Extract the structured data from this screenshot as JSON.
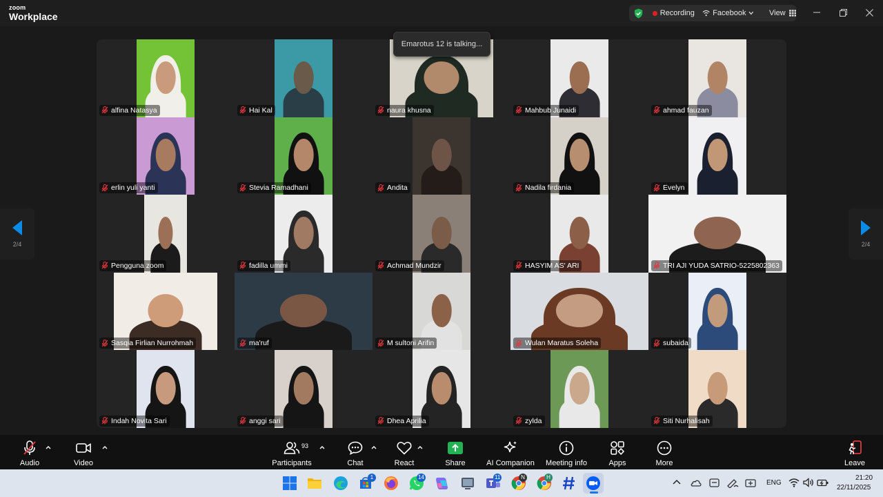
{
  "app": {
    "brand_top": "zoom",
    "brand_bottom": "Workplace"
  },
  "topbar": {
    "recording_label": "Recording",
    "stream_label": "Facebook",
    "view_label": "View"
  },
  "talking_indicator": "Emarotus 12 is talking...",
  "pagination": {
    "left": "2/4",
    "right": "2/4"
  },
  "participants": [
    {
      "name": "alfina Natasya",
      "bg": "#74c235",
      "skin": "#c99a7c",
      "cloth": "#f1efe9",
      "veil": true
    },
    {
      "name": "Hai Kal",
      "bg": "#3c9aa7",
      "skin": "#6a5a4a",
      "cloth": "#2a3e47",
      "veil": false
    },
    {
      "name": "naura khusna",
      "bg": "#d9d4c9",
      "skin": "#b08a6a",
      "cloth": "#1f2a22",
      "veil": true
    },
    {
      "name": "Mahbub Junaidi",
      "bg": "#eaeaea",
      "skin": "#9b6e52",
      "cloth": "#2d2d33",
      "veil": false
    },
    {
      "name": "ahmad fauzan",
      "bg": "#e9e6e2",
      "skin": "#b08464",
      "cloth": "#8c8ca0",
      "veil": false
    },
    {
      "name": "erlin yuli yanti",
      "bg": "#c99ad3",
      "skin": "#a87a60",
      "cloth": "#2b3457",
      "veil": true
    },
    {
      "name": "Stevia Ramadhani",
      "bg": "#5fb04a",
      "skin": "#b5876a",
      "cloth": "#111",
      "veil": true
    },
    {
      "name": "Andita",
      "bg": "#3c342e",
      "skin": "#6d5446",
      "cloth": "#241c18",
      "veil": false
    },
    {
      "name": "Nadila firdania",
      "bg": "#d5d0c8",
      "skin": "#b88e70",
      "cloth": "#111",
      "veil": true
    },
    {
      "name": "Evelyn",
      "bg": "#f0f0f2",
      "skin": "#c19776",
      "cloth": "#1b2030",
      "veil": true
    },
    {
      "name": "Pengguna zoom",
      "bg": "#e8e6e0",
      "skin": "#9c7056",
      "cloth": "#1b1b1b",
      "veil": false
    },
    {
      "name": "fadilla ummi",
      "bg": "#ececec",
      "skin": "#a07a62",
      "cloth": "#2a2a2a",
      "veil": true
    },
    {
      "name": "Achmad Mundzir",
      "bg": "#8a8078",
      "skin": "#7a5c48",
      "cloth": "#2a2a2a",
      "veil": false
    },
    {
      "name": "HASYIM AS' ARI",
      "bg": "#e9e9e9",
      "skin": "#8c6048",
      "cloth": "#7a4032",
      "veil": false
    },
    {
      "name": "TRI AJI YUDA SATRIO-5225802363",
      "bg": "#f1f1f1",
      "skin": "#8f6450",
      "cloth": "#1c1c1c",
      "veil": false
    },
    {
      "name": "Sasqia Firlian Nurrohmah",
      "bg": "#f2ece6",
      "skin": "#cf9c7a",
      "cloth": "#3c2c24",
      "veil": false
    },
    {
      "name": "ma'ruf",
      "bg": "#2c3b46",
      "skin": "#7a5644",
      "cloth": "#1a1a1a",
      "veil": false
    },
    {
      "name": "M sultoni Arifin",
      "bg": "#d8d8d6",
      "skin": "#8b6248",
      "cloth": "#e2e2e2",
      "veil": false
    },
    {
      "name": "Wulan Maratus Soleha",
      "bg": "#d9dde2",
      "skin": "#c49c82",
      "cloth": "#6a3a24",
      "veil": true
    },
    {
      "name": "subaida",
      "bg": "#eaeef6",
      "skin": "#c29a7c",
      "cloth": "#2c4a7a",
      "veil": true
    },
    {
      "name": "Indah Novita Sari",
      "bg": "#dfe4ee",
      "skin": "#c79a7e",
      "cloth": "#151515",
      "veil": true
    },
    {
      "name": "anggi sari",
      "bg": "#d8d0ca",
      "skin": "#a27a60",
      "cloth": "#151515",
      "veil": true
    },
    {
      "name": "Dhea Aprilia",
      "bg": "#e6e6e6",
      "skin": "#b88c6c",
      "cloth": "#242424",
      "veil": true
    },
    {
      "name": "zylda",
      "bg": "#6c9a56",
      "skin": "#c9a88c",
      "cloth": "#e8e8e8",
      "veil": true
    },
    {
      "name": "Siti Nurhalisah",
      "bg": "#f0dcc6",
      "skin": "#c79a7a",
      "cloth": "#2a2a2a",
      "veil": false
    }
  ],
  "toolbar": {
    "audio": "Audio",
    "video": "Video",
    "participants": "Participants",
    "participants_count": "93",
    "chat": "Chat",
    "react": "React",
    "share": "Share",
    "ai_companion": "AI Companion",
    "meeting_info": "Meeting info",
    "apps": "Apps",
    "more": "More",
    "leave": "Leave"
  },
  "taskbar": {
    "language": "ENG",
    "time": "21:20",
    "date": "22/11/2025",
    "badges": {
      "store": "1",
      "whatsapp": "14",
      "teams": "11",
      "chrome1": "N",
      "chrome2": "H"
    }
  },
  "colors": {
    "share_green": "#23b253",
    "leave_red": "#e0383e",
    "accent_blue": "#0b8ae6"
  }
}
